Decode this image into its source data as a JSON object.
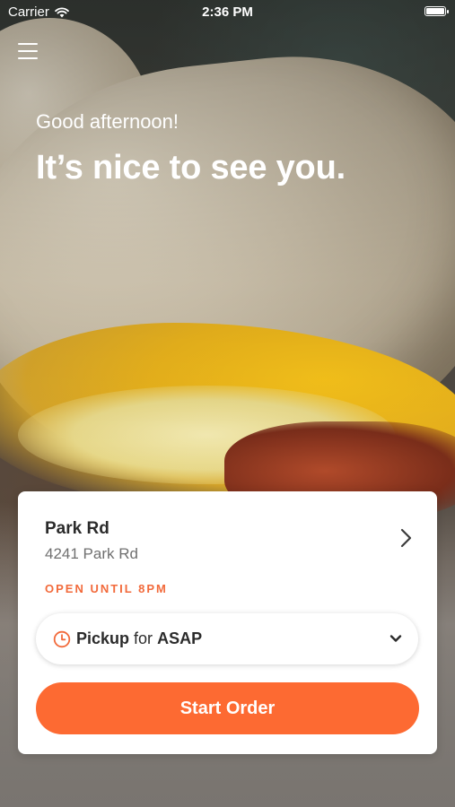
{
  "status_bar": {
    "carrier": "Carrier",
    "time": "2:36 PM"
  },
  "greeting": "Good afternoon!",
  "headline": "It’s nice to see you.",
  "location": {
    "name": "Park Rd",
    "address": "4241 Park Rd",
    "hours": "OPEN UNTIL 8PM"
  },
  "order": {
    "mode": "Pickup",
    "connector": "for",
    "time": "ASAP"
  },
  "actions": {
    "start_order": "Start Order"
  },
  "colors": {
    "accent": "#fd6a32",
    "hours_text": "#f26a3b"
  },
  "icons": [
    "wifi-icon",
    "battery-icon",
    "menu-icon",
    "chevron-right-icon",
    "clock-icon",
    "chevron-down-icon"
  ]
}
